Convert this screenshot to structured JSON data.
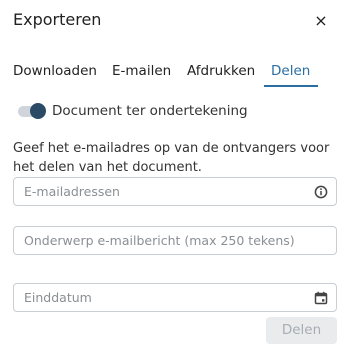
{
  "dialog": {
    "title": "Exporteren",
    "close_symbol": "×"
  },
  "tabs": [
    {
      "label": "Downloaden",
      "active": false
    },
    {
      "label": "E-mailen",
      "active": false
    },
    {
      "label": "Afdrukken",
      "active": false
    },
    {
      "label": "Delen",
      "active": true
    }
  ],
  "toggle": {
    "label": "Document ter ondertekening",
    "state": "off"
  },
  "instructions": "Geef het e-mailadres op van de ontvangers voor het delen van het document.",
  "fields": {
    "emails": {
      "placeholder": "E-mailadressen",
      "value": "",
      "icon": "info-icon"
    },
    "subject": {
      "placeholder": "Onderwerp e-mailbericht (max 250 tekens)",
      "value": ""
    },
    "end_date": {
      "placeholder": "Einddatum",
      "value": "",
      "icon": "calendar-icon"
    }
  },
  "actions": {
    "share_label": "Delen",
    "share_enabled": false
  },
  "colors": {
    "accent": "#2a6ea4",
    "toggle_knob": "#2a4a66",
    "disabled_bg": "#e9ebed",
    "disabled_text": "#a7adb3"
  }
}
